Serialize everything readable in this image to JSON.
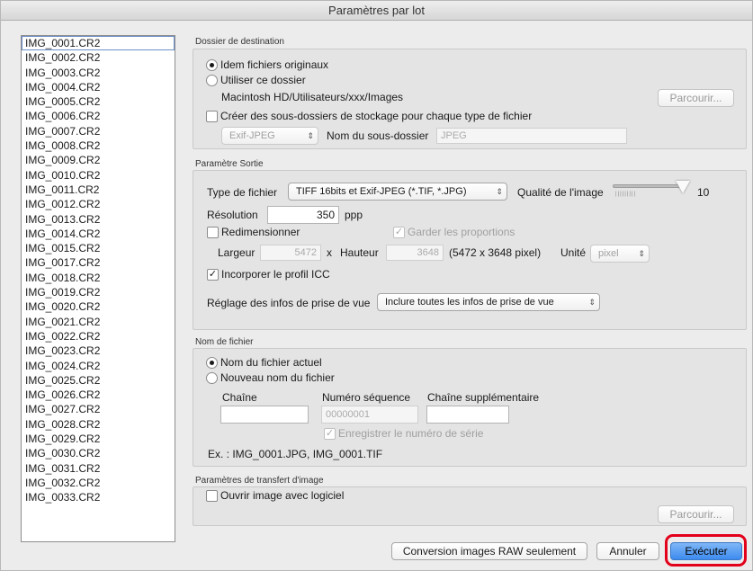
{
  "window": {
    "title": "Paramètres par lot"
  },
  "files": [
    "IMG_0001.CR2",
    "IMG_0002.CR2",
    "IMG_0003.CR2",
    "IMG_0004.CR2",
    "IMG_0005.CR2",
    "IMG_0006.CR2",
    "IMG_0007.CR2",
    "IMG_0008.CR2",
    "IMG_0009.CR2",
    "IMG_0010.CR2",
    "IMG_0011.CR2",
    "IMG_0012.CR2",
    "IMG_0013.CR2",
    "IMG_0014.CR2",
    "IMG_0015.CR2",
    "IMG_0017.CR2",
    "IMG_0018.CR2",
    "IMG_0019.CR2",
    "IMG_0020.CR2",
    "IMG_0021.CR2",
    "IMG_0022.CR2",
    "IMG_0023.CR2",
    "IMG_0024.CR2",
    "IMG_0025.CR2",
    "IMG_0026.CR2",
    "IMG_0027.CR2",
    "IMG_0028.CR2",
    "IMG_0029.CR2",
    "IMG_0030.CR2",
    "IMG_0031.CR2",
    "IMG_0032.CR2",
    "IMG_0033.CR2"
  ],
  "destination": {
    "group_label": "Dossier de destination",
    "radio_same": "Idem fichiers originaux",
    "radio_use": "Utiliser ce dossier",
    "path": "Macintosh HD/Utilisateurs/xxx/Images",
    "browse": "Parcourir...",
    "subfolders_check": "Créer des sous-dossiers de stockage pour chaque type de fichier",
    "subfolder_type": "Exif-JPEG",
    "subfolder_name_label": "Nom du sous-dossier",
    "subfolder_name_value": "JPEG"
  },
  "output": {
    "group_label": "Paramètre Sortie",
    "file_type_label": "Type de fichier",
    "file_type_value": "TIFF 16bits et Exif-JPEG (*.TIF, *.JPG)",
    "quality_label": "Qualité de l'image",
    "quality_value": "10",
    "resolution_label": "Résolution",
    "resolution_value": "350",
    "resolution_unit": "ppp",
    "resize_check": "Redimensionner",
    "keep_ratio_check": "Garder les proportions",
    "width_label": "Largeur",
    "width_value": "5472",
    "times": "x",
    "height_label": "Hauteur",
    "height_value": "3648",
    "pixel_info": "(5472 x 3648 pixel)",
    "unit_label": "Unité",
    "unit_value": "pixel",
    "icc_check": "Incorporer le profil ICC",
    "shooting_label": "Réglage des infos de prise de vue",
    "shooting_value": "Inclure toutes les infos de prise de vue"
  },
  "filename": {
    "group_label": "Nom de fichier",
    "radio_current": "Nom du fichier actuel",
    "radio_new": "Nouveau nom du fichier",
    "chain_label": "Chaîne",
    "seq_label": "Numéro séquence",
    "seq_value": "00000001",
    "extra_label": "Chaîne supplémentaire",
    "serial_check": "Enregistrer le numéro de série",
    "example": "Ex. :  IMG_0001.JPG, IMG_0001.TIF"
  },
  "transfer": {
    "group_label": "Paramètres de transfert d'image",
    "open_check": "Ouvrir image avec logiciel",
    "browse": "Parcourir..."
  },
  "footer": {
    "raw_only": "Conversion images RAW seulement",
    "cancel": "Annuler",
    "execute": "Exécuter"
  },
  "colors": {
    "highlight": "#e3001b",
    "default_button": "#3d8bef"
  }
}
